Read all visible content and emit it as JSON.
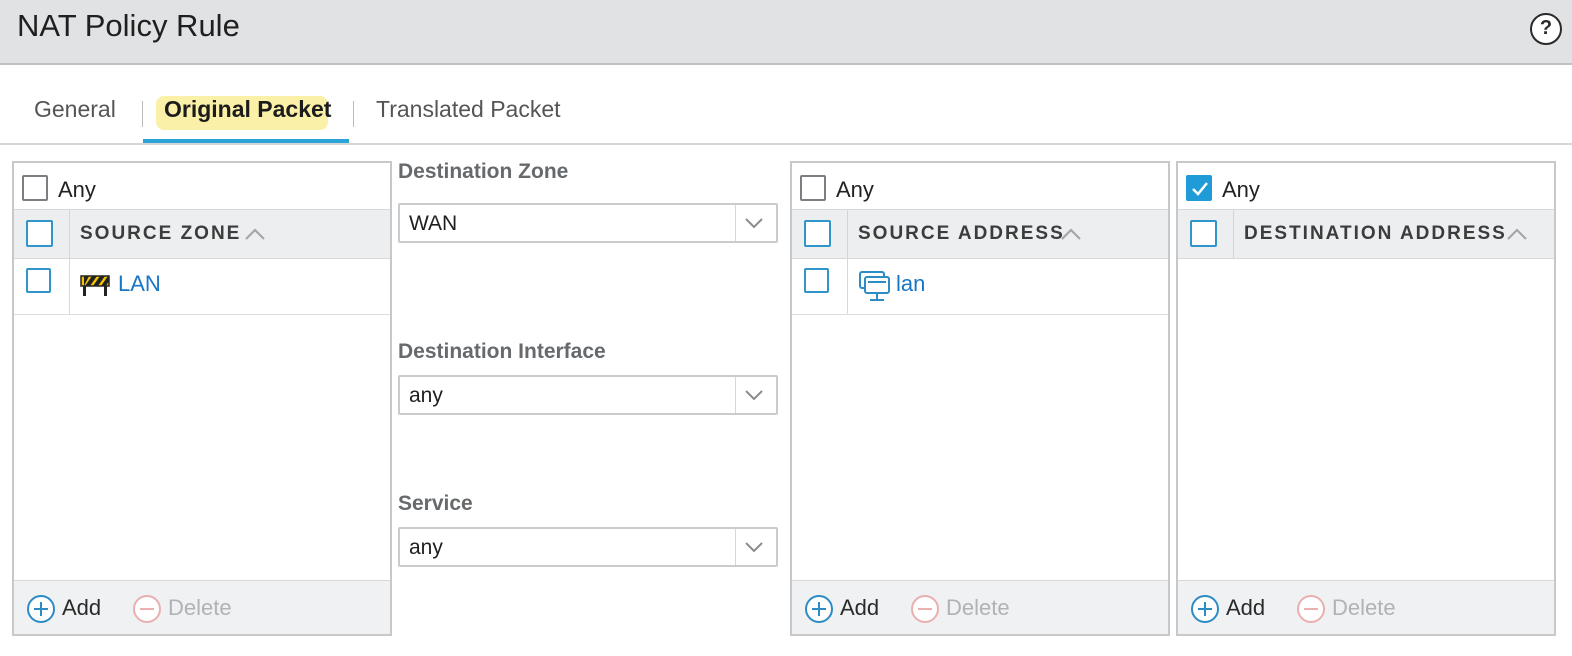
{
  "window": {
    "title": "NAT Policy Rule",
    "help_glyph": "?"
  },
  "tabs": [
    {
      "label": "General",
      "active": false
    },
    {
      "label": "Original Packet",
      "active": true
    },
    {
      "label": "Translated Packet",
      "active": false
    }
  ],
  "source_zone_panel": {
    "any_label": "Any",
    "any_checked": false,
    "column_header": "SOURCE ZONE",
    "rows": [
      {
        "label": "LAN",
        "icon": "zone-icon"
      }
    ],
    "add_label": "Add",
    "delete_label": "Delete"
  },
  "destination": {
    "zone_label": "Destination Zone",
    "zone_value": "WAN",
    "interface_label": "Destination Interface",
    "interface_value": "any",
    "service_label": "Service",
    "service_value": "any"
  },
  "source_address_panel": {
    "any_label": "Any",
    "any_checked": false,
    "column_header": "SOURCE ADDRESS",
    "rows": [
      {
        "label": "lan",
        "icon": "address-object-icon"
      }
    ],
    "add_label": "Add",
    "delete_label": "Delete"
  },
  "destination_address_panel": {
    "any_label": "Any",
    "any_checked": true,
    "column_header": "DESTINATION ADDRESS",
    "rows": [],
    "add_label": "Add",
    "delete_label": "Delete"
  },
  "colors": {
    "accent": "#1f9bd7",
    "link": "#1877c5",
    "active_tab_highlight": "#fbf0a8",
    "title_bar": "#e1e2e3"
  }
}
